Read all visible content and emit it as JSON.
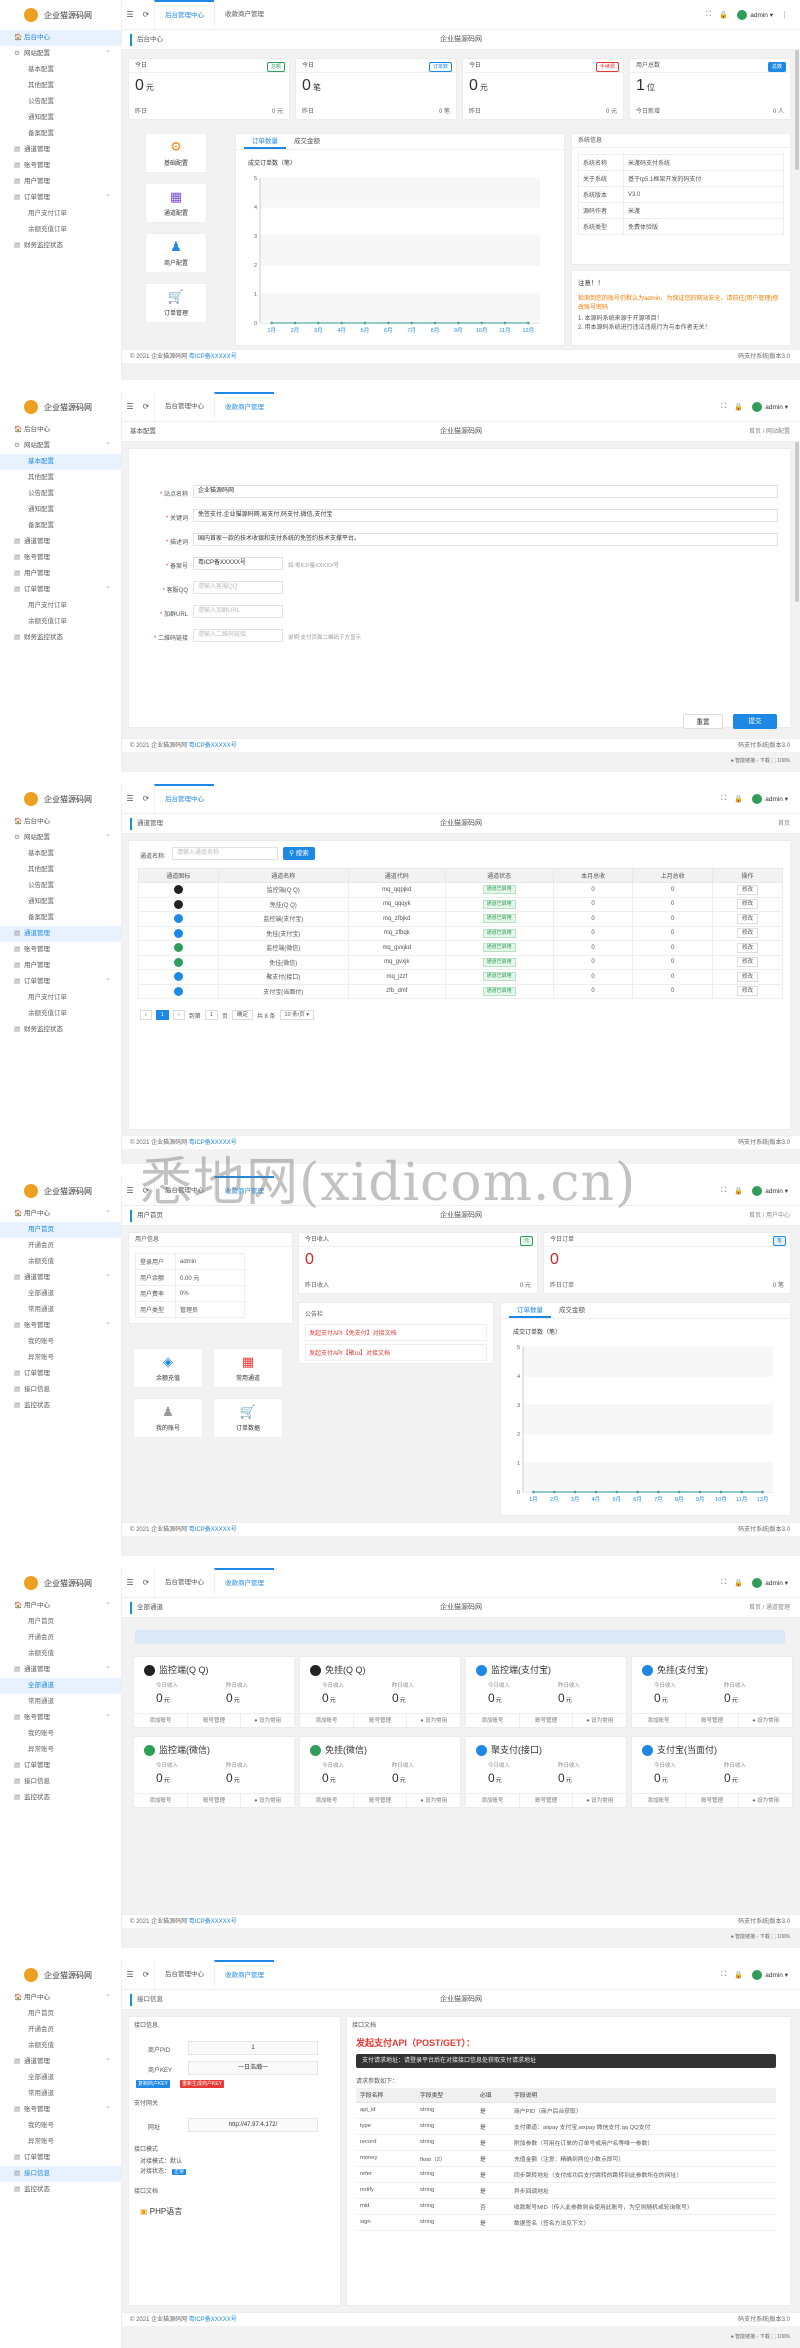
{
  "app": {
    "logo": "企业猫源码网",
    "footer_copy": "© 2021 企业猫源码网",
    "footer_icp": "粤ICP备XXXXX号",
    "footer_right": "码支付系统|版本3.0",
    "user": "admin ▾",
    "taskbar": "● 智能链接   ◦ 下载   ⬚ 100%"
  },
  "admin_menu": [
    {
      "label": "后台中心",
      "icon": "🏠"
    },
    {
      "label": "网站配置",
      "icon": "⚙",
      "arrow": "⌃"
    },
    {
      "label": "基本配置",
      "sub": true
    },
    {
      "label": "其他配置",
      "sub": true
    },
    {
      "label": "公告配置",
      "sub": true
    },
    {
      "label": "通知配置",
      "sub": true
    },
    {
      "label": "备案配置",
      "sub": true
    },
    {
      "label": "通道管理",
      "icon": "▤"
    },
    {
      "label": "账号管理",
      "icon": "▤"
    },
    {
      "label": "用户管理",
      "icon": "▤"
    },
    {
      "label": "订单管理",
      "icon": "▤",
      "arrow": "⌃"
    },
    {
      "label": "用户支付订单",
      "sub": true
    },
    {
      "label": "余额充值订单",
      "sub": true
    },
    {
      "label": "财务监控状态",
      "icon": "▤"
    }
  ],
  "user_menu": [
    {
      "label": "用户中心",
      "icon": "🏠",
      "arrow": "⌃"
    },
    {
      "label": "用户首页",
      "sub": true
    },
    {
      "label": "开通会员",
      "sub": true
    },
    {
      "label": "余额充值",
      "sub": true
    },
    {
      "label": "通道管理",
      "icon": "▤",
      "arrow": "⌃"
    },
    {
      "label": "全部通道",
      "sub": true
    },
    {
      "label": "常用通道",
      "sub": true
    },
    {
      "label": "账号管理",
      "icon": "▤",
      "arrow": "⌃"
    },
    {
      "label": "我的账号",
      "sub": true
    },
    {
      "label": "异常账号",
      "sub": true
    },
    {
      "label": "订单管理",
      "icon": "▤"
    },
    {
      "label": "接口信息",
      "icon": "▤"
    },
    {
      "label": "监控状态",
      "icon": "▤"
    }
  ],
  "p1": {
    "tabs": [
      "后台管理中心",
      "收款商户管理"
    ],
    "crumb": "后台中心",
    "site": "企业猫源码网",
    "stats": [
      {
        "title": "今日",
        "badge": "总额",
        "badge_color": "#2e9e5a",
        "value": "0",
        "unit": "元",
        "left": "昨日",
        "right": "0 元"
      },
      {
        "title": "今日",
        "badge": "订单数",
        "badge_color": "#1e88e5",
        "value": "0",
        "unit": "笔",
        "left": "昨日",
        "right": "0 笔"
      },
      {
        "title": "今日",
        "badge": "手续费",
        "badge_color": "#e53935",
        "value": "0",
        "unit": "元",
        "left": "昨日",
        "right": "0 元"
      },
      {
        "title": "用户总数",
        "badge": "总数",
        "badge_color": "#1e88e5",
        "value": "1",
        "unit": "位",
        "left": "今日新增",
        "right": "0 人"
      }
    ],
    "quick": [
      {
        "label": "基础配置",
        "icon": "⚙",
        "color": "#f08a24"
      },
      {
        "label": "通道配置",
        "icon": "▦",
        "color": "#7b4fd6"
      },
      {
        "label": "商户配置",
        "icon": "♟",
        "color": "#1e88e5"
      },
      {
        "label": "订单管理",
        "icon": "🛒",
        "color": "#2e9e5a"
      }
    ],
    "chart_tabs": [
      "订单数量",
      "成交金额"
    ],
    "chart_title": "成交订单数（笔）",
    "sysinfo_title": "系统信息",
    "sysinfo": [
      {
        "k": "系统名称",
        "v": "米渡码支付系统"
      },
      {
        "k": "关于系统",
        "v": "基于tp5.1框架开发的码支付"
      },
      {
        "k": "系统版本",
        "v": "V3.0"
      },
      {
        "k": "源码作者",
        "v": "米渡",
        "link": true
      },
      {
        "k": "系统类型",
        "v": "免费体验版",
        "link": true
      }
    ],
    "notice_title": "注意！！",
    "notice_red": "检测到您的账号仍默认为admin，为保证您的网站安全，请前往(用户管理)修改账号密码",
    "notice_1": "1. 本源码系统来源于开源项目！",
    "notice_2": "2. 用本源码系统进行违法违规行为与本作者无关！"
  },
  "chart_data": [
    {
      "type": "line",
      "title": "成交订单数（笔）",
      "categories": [
        "1月",
        "2月",
        "3月",
        "4月",
        "5月",
        "6月",
        "7月",
        "8月",
        "9月",
        "10月",
        "11月",
        "12月"
      ],
      "values": [
        0,
        0,
        0,
        0,
        0,
        0,
        0,
        0,
        0,
        0,
        0,
        0
      ],
      "y_ticks": [
        "0",
        "1",
        "2",
        "3",
        "4",
        "5"
      ],
      "ylim": [
        0,
        5
      ]
    },
    {
      "type": "line",
      "title": "成交订单数（笔）",
      "categories": [
        "1月",
        "2月",
        "3月",
        "4月",
        "5月",
        "6月",
        "7月",
        "8月",
        "9月",
        "10月",
        "11月",
        "12月"
      ],
      "values": [
        0,
        0,
        0,
        0,
        0,
        0,
        0,
        0,
        0,
        0,
        0,
        0
      ],
      "y_ticks": [
        "0",
        "1",
        "2",
        "3",
        "4",
        "5"
      ],
      "ylim": [
        0,
        5
      ]
    }
  ],
  "p2": {
    "crumb": "基本配置",
    "site": "企业猫源码网",
    "right": "首页 / 网站配置",
    "fields": [
      {
        "label": "站点名称",
        "value": "企业猫源码网",
        "req": true
      },
      {
        "label": "关键词",
        "value": "免签支付,企业猫源码网,易支付,码支付,微信,支付宝",
        "req": true
      },
      {
        "label": "描述词",
        "value": "国内首家一款的技术收银和支付系统的免签约技术支撑平台。",
        "req": true
      },
      {
        "label": "备案号",
        "value": "粤ICP备XXXXX号",
        "hint": "如:粤ICP备XXXXX号",
        "req": true
      },
      {
        "label": "客服QQ",
        "value": "请输入客服QQ",
        "ph": true,
        "req": true
      },
      {
        "label": "加群URL",
        "value": "请输入加群URL",
        "ph": true,
        "req": true
      },
      {
        "label": "二维码链接",
        "value": "请输入二维码链接",
        "ph": true,
        "hint": "说明:支付页面二维码下方显示",
        "req": true
      }
    ],
    "reset": "重置",
    "submit": "提交"
  },
  "p3": {
    "crumb": "通道管理",
    "site": "企业猫源码网",
    "right": "首页",
    "search_label": "通道名称:",
    "search_ph": "请输入通道名称",
    "search_btn": "搜索",
    "cols": [
      "通道图标",
      "通道名称",
      "通道代码",
      "通道状态",
      "本月总收",
      "上月总收",
      "操作"
    ],
    "rows": [
      {
        "name": "监控端(Q Q)",
        "code": "mq_qqpjkd",
        "status": "通道已启用",
        "m": "0",
        "l": "0",
        "op": "修改",
        "color": "#222"
      },
      {
        "name": "免挂(Q Q)",
        "code": "mq_qqqyk",
        "status": "通道已启用",
        "m": "0",
        "l": "0",
        "op": "修改",
        "color": "#222"
      },
      {
        "name": "监控端(支付宝)",
        "code": "mq_zfbjkd",
        "status": "通道已启用",
        "m": "0",
        "l": "0",
        "op": "修改",
        "color": "#1e88e5"
      },
      {
        "name": "免挂(支付宝)",
        "code": "mq_zfbqk",
        "status": "通道已启用",
        "m": "0",
        "l": "0",
        "op": "修改",
        "color": "#1e88e5"
      },
      {
        "name": "监控端(微信)",
        "code": "mq_gvxjkd",
        "status": "通道已启用",
        "m": "0",
        "l": "0",
        "op": "修改",
        "color": "#2e9e5a"
      },
      {
        "name": "免挂(微信)",
        "code": "mq_gvxjk",
        "status": "通道已启用",
        "m": "0",
        "l": "0",
        "op": "修改",
        "color": "#2e9e5a"
      },
      {
        "name": "聚支付(接口)",
        "code": "mq_jzzf",
        "status": "通道已启用",
        "m": "0",
        "l": "0",
        "op": "修改",
        "color": "#1e88e5"
      },
      {
        "name": "支付宝(当面付)",
        "code": "zfb_dmf",
        "status": "通道已启用",
        "m": "0",
        "l": "0",
        "op": "修改",
        "color": "#1e88e5"
      }
    ],
    "pager": {
      "prev": "‹",
      "page": "1",
      "next": "›",
      "goto": "到第",
      "goto_val": "1",
      "page_unit": "页",
      "confirm": "确定",
      "total": "共 8 条",
      "per": "10 条/页 ▾"
    }
  },
  "p4": {
    "tabs": [
      "后台管理中心",
      "收款商户管理"
    ],
    "crumb": "用户首页",
    "site": "企业猫源码网",
    "right": "首页 / 用户中心",
    "info_title": "用户信息",
    "info": [
      {
        "k": "登录用户",
        "v": "admin"
      },
      {
        "k": "用户余额",
        "v": "0.00 元"
      },
      {
        "k": "用户费率",
        "v": "0%"
      },
      {
        "k": "用户类型",
        "v": "管理员"
      }
    ],
    "income": {
      "title": "今日收入",
      "badge": "元",
      "value": "0",
      "left": "昨日收入",
      "right": "0 元"
    },
    "orders": {
      "title": "今日订单",
      "badge": "笔",
      "value": "0",
      "left": "昨日订单",
      "right": "0 笔"
    },
    "notice_title": "公告栏",
    "notices": [
      "发起支付API【免支付】对接文档",
      "发起支付API【聚ru】对接文档"
    ],
    "quick": [
      {
        "label": "余额充值",
        "icon": "◈",
        "color": "#1e88e5"
      },
      {
        "label": "常用通道",
        "icon": "▦",
        "color": "#e53935"
      },
      {
        "label": "我的账号",
        "icon": "♟",
        "color": "#999"
      },
      {
        "label": "订单数据",
        "icon": "🛒",
        "color": "#2e9e5a"
      }
    ],
    "chart_tabs": [
      "订单数量",
      "成交金额"
    ],
    "chart_title": "成交订单数（笔）"
  },
  "p5": {
    "tabs": [
      "后台管理中心",
      "收款商户管理"
    ],
    "crumb": "全部通道",
    "site": "企业猫源码网",
    "right": "首页 / 通道管理",
    "today_label": "今日收入",
    "yest_label": "昨日收入",
    "unit": "元",
    "actions": [
      "添加账号",
      "账号管理",
      "● 设为常用"
    ],
    "channels": [
      {
        "name": "监控端(Q Q)",
        "color": "#222"
      },
      {
        "name": "免挂(Q Q)",
        "color": "#222"
      },
      {
        "name": "监控端(支付宝)",
        "color": "#1e88e5"
      },
      {
        "name": "免挂(支付宝)",
        "color": "#1e88e5"
      },
      {
        "name": "监控端(微信)",
        "color": "#2e9e5a"
      },
      {
        "name": "免挂(微信)",
        "color": "#2e9e5a"
      },
      {
        "name": "聚支付(接口)",
        "color": "#1e88e5"
      },
      {
        "name": "支付宝(当面付)",
        "color": "#1e88e5"
      }
    ]
  },
  "p6": {
    "tabs": [
      "后台管理中心",
      "收款商户管理"
    ],
    "crumb": "接口信息",
    "site": "企业猫源码网",
    "right": "",
    "left_title": "接口信息",
    "pid_label": "商户PID",
    "pid": "1",
    "key_label": "商户KEY",
    "key": "一日浩瀚一",
    "tag1": "复制商户KEY",
    "tag2": "重新生成商户KEY",
    "gateway_title": "支付网关",
    "gw_label": "网址",
    "gw": "http://47.97.4.172/",
    "listen_title": "接口模式",
    "listen_1": "对接模式：默认",
    "listen_2": "对接状态：",
    "listen_tag": "正常",
    "doc_title": "接口文档",
    "doc_lang": "PHP语言",
    "api_title": "接口文档",
    "api_heading": "发起支付API（POST/GET）：",
    "api_bar": "支付请求地址：请登录平台后在对接接口信息处获取支付请求地址",
    "api_param_title": "请求参数如下：",
    "api_cols": [
      "字段名称",
      "字段类型",
      "必填",
      "字段说明"
    ],
    "api_rows": [
      [
        "api_id",
        "string",
        "是",
        "商户PID（商户后台获取）"
      ],
      [
        "type",
        "string",
        "是",
        "支付渠道：alipay 支付宝,wxpay 微信支付,qq QQ支付"
      ],
      [
        "record",
        "string",
        "是",
        "附加参数（可用在订单的订单号或用户名等唯一参数）"
      ],
      [
        "money",
        "float（2）",
        "是",
        "充值金额（注意：精确到两位小数点即可）"
      ],
      [
        "refer",
        "string",
        "是",
        "同步跳转地址（支付成功后支付跳转的跳转到此参数所在的网址）"
      ],
      [
        "notify",
        "string",
        "是",
        "异步回调地址"
      ],
      [
        "mid",
        "string",
        "否",
        "收款账号MID（传入此参数则会使用此账号，为空则随机或轮询账号）"
      ],
      [
        "sign",
        "string",
        "是",
        "数据签名（签名方法见下文）"
      ]
    ]
  }
}
